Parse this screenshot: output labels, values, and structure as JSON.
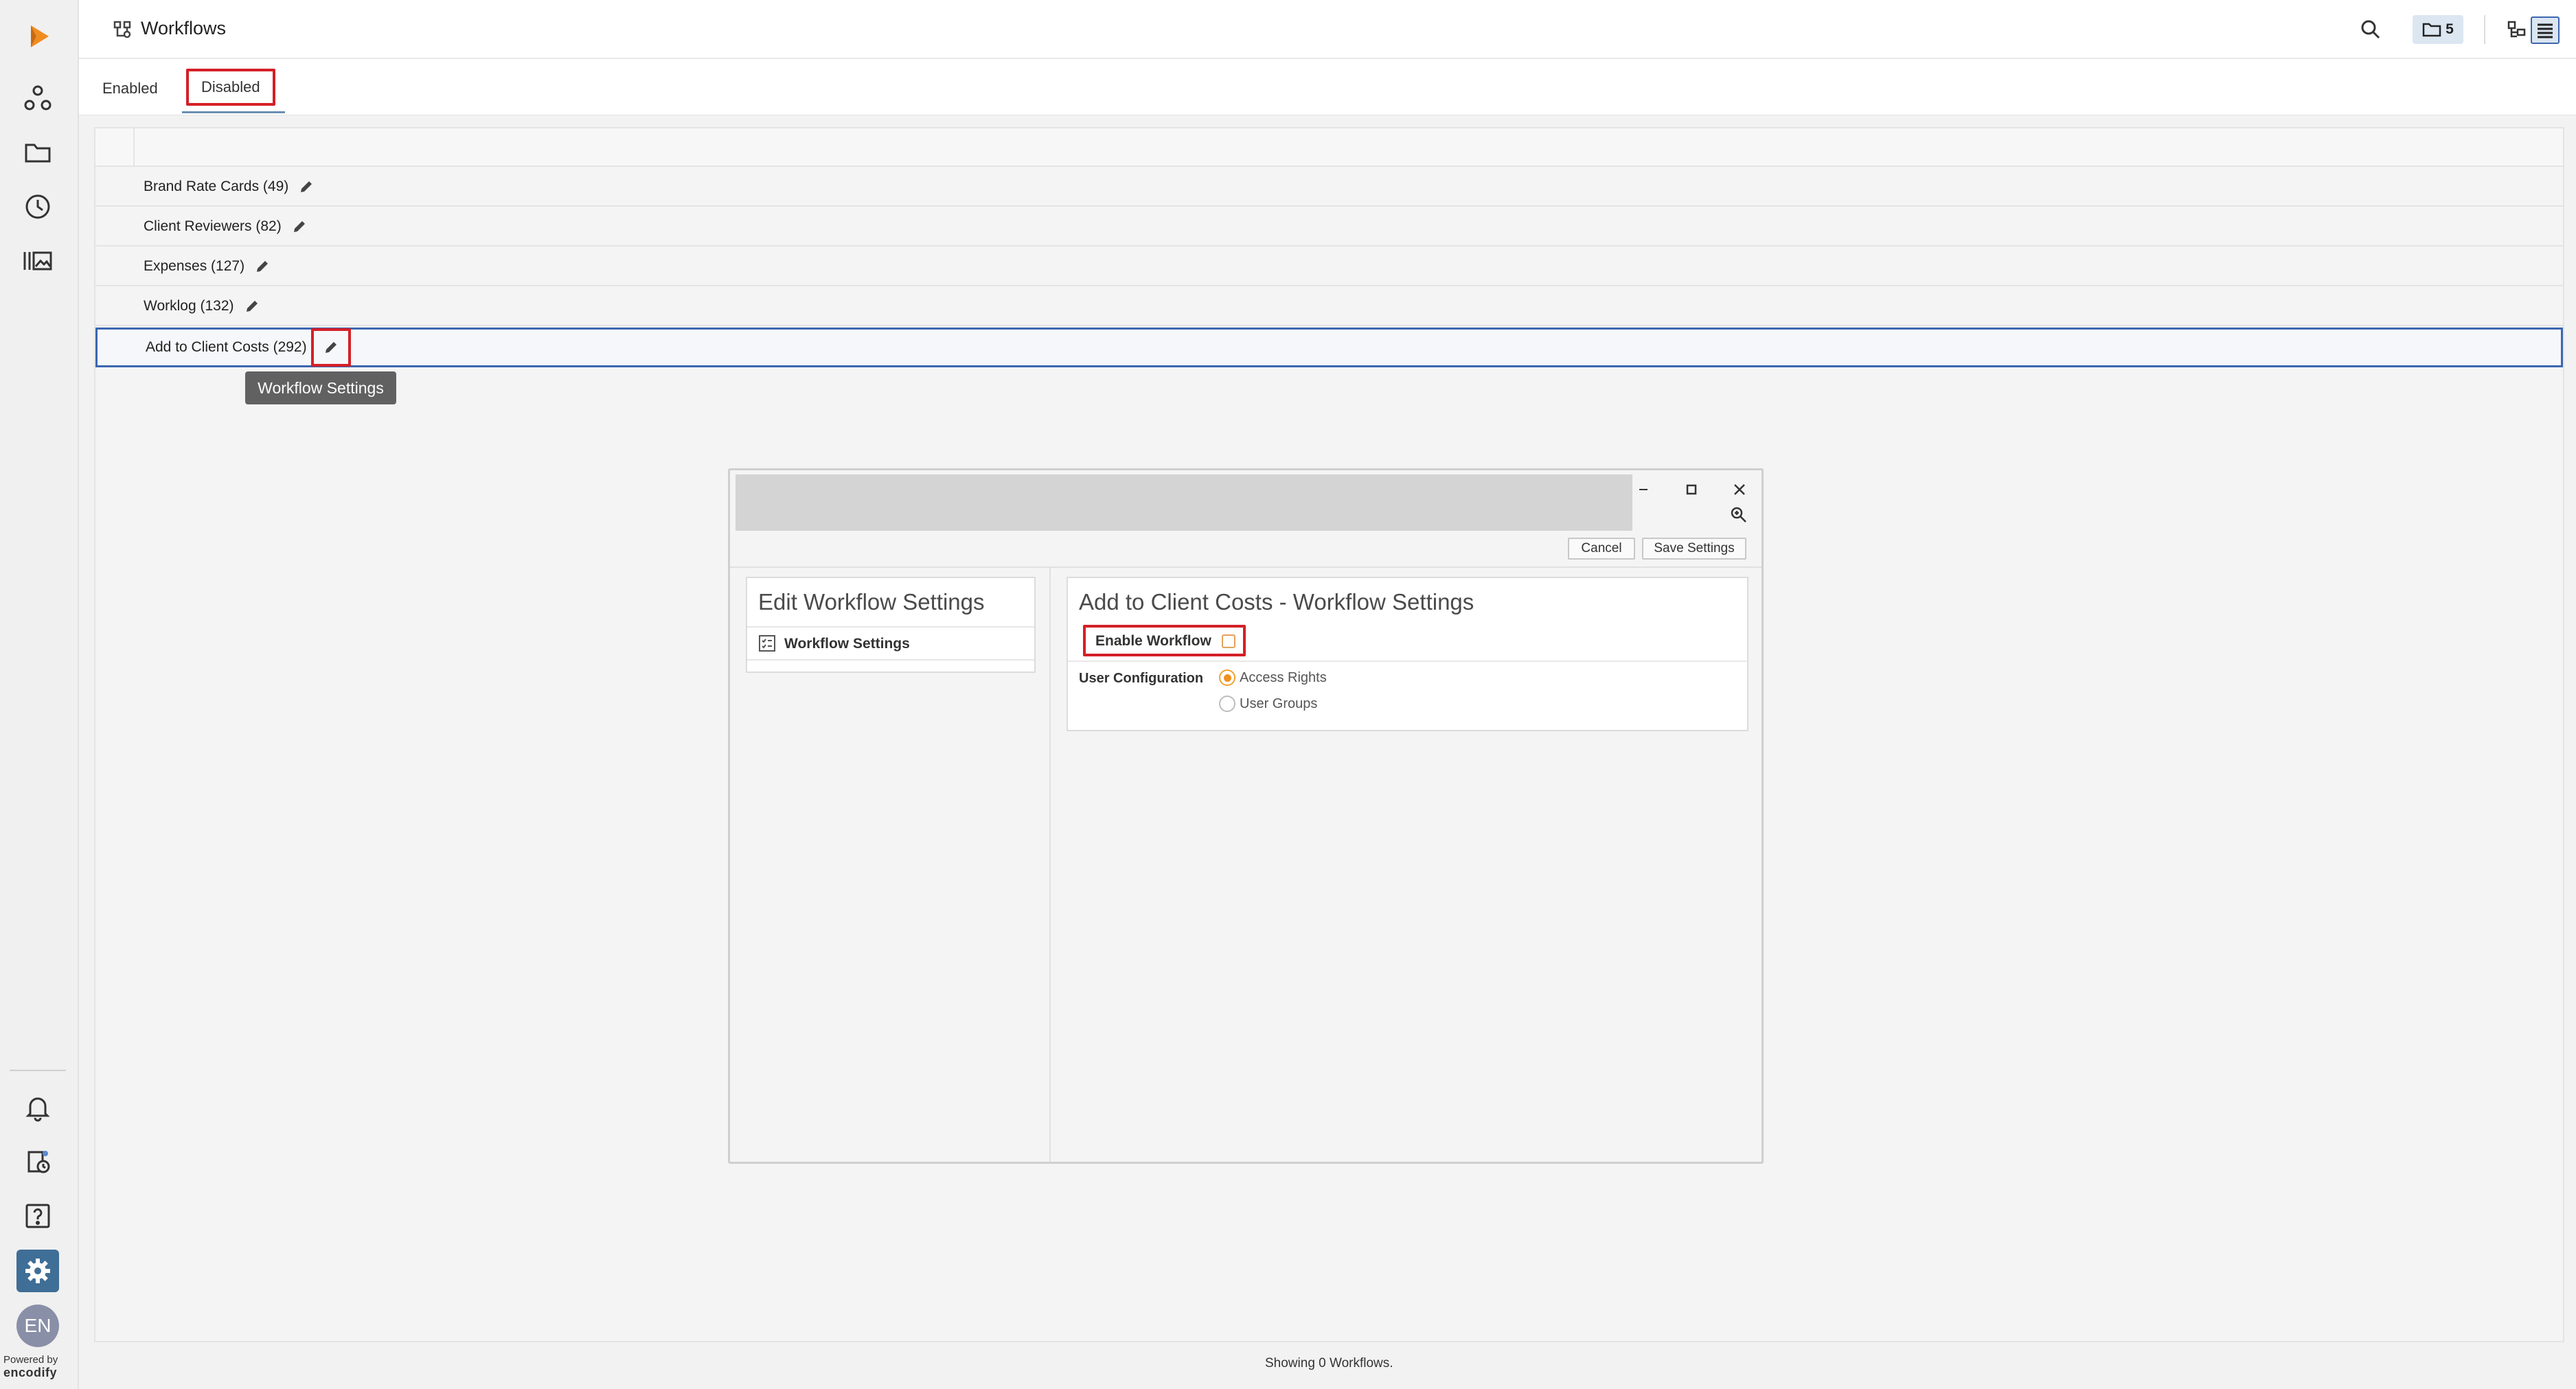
{
  "header": {
    "title": "Workflows",
    "folder_count": "5"
  },
  "tabs": [
    {
      "label": "Enabled"
    },
    {
      "label": "Disabled"
    }
  ],
  "rows": [
    {
      "label": "Brand Rate Cards (49)"
    },
    {
      "label": "Client Reviewers (82)"
    },
    {
      "label": "Expenses (127)"
    },
    {
      "label": "Worklog (132)"
    },
    {
      "label": "Add to Client Costs (292)"
    }
  ],
  "tooltip": "Workflow Settings",
  "footer": "Showing 0 Workflows.",
  "sidebar": {
    "avatar": "EN",
    "powered_by": "Powered by",
    "brand": "encodify"
  },
  "dialog": {
    "cancel": "Cancel",
    "save": "Save Settings",
    "left_title": "Edit Workflow Settings",
    "left_item": "Workflow Settings",
    "right_title": "Add to Client Costs - Workflow Settings",
    "enable_label": "Enable Workflow",
    "user_config_label": "User Configuration",
    "options": [
      {
        "label": "Access Rights"
      },
      {
        "label": "User Groups"
      }
    ]
  },
  "colors": {
    "accent": "#f08c1e",
    "highlight": "#d42027",
    "selection": "#3c66b0",
    "active_nav": "#3f6e96"
  }
}
